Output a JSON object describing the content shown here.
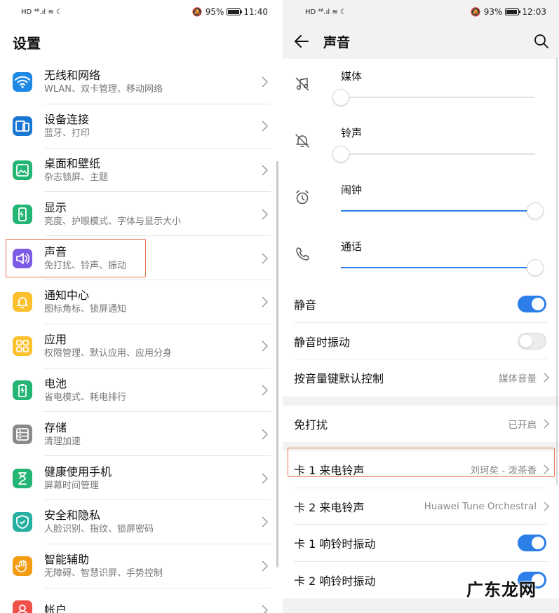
{
  "left": {
    "status": {
      "left_icons": "HD ⁴⁶.ıl ≋ ☾",
      "battery": "95%",
      "time": "11:40",
      "battery_fill": 0.95
    },
    "title": "设置",
    "items": [
      {
        "title": "无线和网络",
        "subtitle": "WLAN、双卡管理、移动网络",
        "icon": "wifi-icon",
        "color": "#1e88e5"
      },
      {
        "title": "设备连接",
        "subtitle": "蓝牙、打印",
        "icon": "device-connection-icon",
        "color": "#1976d2"
      },
      {
        "title": "桌面和壁纸",
        "subtitle": "杂志锁屏、主题",
        "icon": "wallpaper-icon",
        "color": "#22b573"
      },
      {
        "title": "显示",
        "subtitle": "亮度、护眼模式、字体与显示大小",
        "icon": "display-icon",
        "color": "#22b573"
      },
      {
        "title": "声音",
        "subtitle": "免打扰、铃声、振动",
        "icon": "sound-icon",
        "color": "#7d5be6"
      },
      {
        "title": "通知中心",
        "subtitle": "图标角标、锁屏通知",
        "icon": "notification-icon",
        "color": "#fbc02d"
      },
      {
        "title": "应用",
        "subtitle": "权限管理、默认应用、应用分身",
        "icon": "apps-icon",
        "color": "#fbc02d"
      },
      {
        "title": "电池",
        "subtitle": "省电模式、耗电排行",
        "icon": "battery-icon",
        "color": "#22b573"
      },
      {
        "title": "存储",
        "subtitle": "清理加速",
        "icon": "storage-icon",
        "color": "#8a8a8a"
      },
      {
        "title": "健康使用手机",
        "subtitle": "屏幕时间管理",
        "icon": "hourglass-icon",
        "color": "#22b573"
      },
      {
        "title": "安全和隐私",
        "subtitle": "人脸识别、指纹、锁屏密码",
        "icon": "shield-icon",
        "color": "#26b0a0"
      },
      {
        "title": "智能辅助",
        "subtitle": "无障碍、智慧识屏、手势控制",
        "icon": "hand-icon",
        "color": "#f39c12"
      },
      {
        "title": "帐户",
        "subtitle": "",
        "icon": "account-icon",
        "color": "#f0504a"
      }
    ],
    "highlight_color": "#e8764f"
  },
  "right": {
    "status": {
      "left_icons": "HD ⁴⁶.ıl ≋ ☾",
      "battery": "93%",
      "time": "12:03",
      "battery_fill": 0.93
    },
    "title": "声音",
    "volumes": [
      {
        "label": "媒体",
        "icon": "media-muted-icon",
        "level": 0.0
      },
      {
        "label": "铃声",
        "icon": "ringer-muted-icon",
        "level": 0.0
      },
      {
        "label": "闹钟",
        "icon": "alarm-icon",
        "level": 1.0
      },
      {
        "label": "通话",
        "icon": "phone-icon",
        "level": 1.0
      }
    ],
    "silent": {
      "label": "静音",
      "on": true
    },
    "silent_vibrate": {
      "label": "静音时振动",
      "on": false
    },
    "volume_key": {
      "label": "按音量键默认控制",
      "value": "媒体音量"
    },
    "dnd": {
      "label": "免打扰",
      "value": "已开启"
    },
    "sim1_ringtone": {
      "label": "卡 1 来电铃声",
      "value": "刘珂矣 - 泼茶香"
    },
    "sim2_ringtone": {
      "label": "卡 2 来电铃声",
      "value": "Huawei Tune Orchestral"
    },
    "sim1_vibrate": {
      "label": "卡 1 响铃时振动",
      "on": true
    },
    "sim2_vibrate": {
      "label": "卡 2 响铃时振动",
      "on": true
    },
    "accent_color": "#2c7fe8"
  },
  "watermark": "广东龙网"
}
